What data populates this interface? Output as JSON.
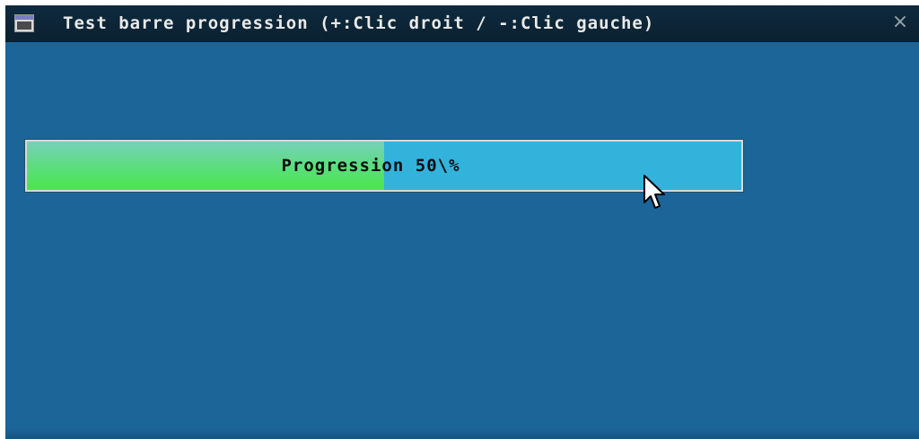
{
  "window": {
    "title": "Test barre progression (+:Clic droit / -:Clic gauche)",
    "close_label": "×"
  },
  "progress": {
    "label": "Progression 50\\%",
    "value": 0.5
  },
  "colors": {
    "background": "#1b6599",
    "titlebar": "#0d2638",
    "track": "#33b2dc",
    "fill": "#49e64a"
  },
  "icons": {
    "app": "app-window-icon",
    "close": "close-icon",
    "cursor": "mouse-pointer-icon"
  }
}
